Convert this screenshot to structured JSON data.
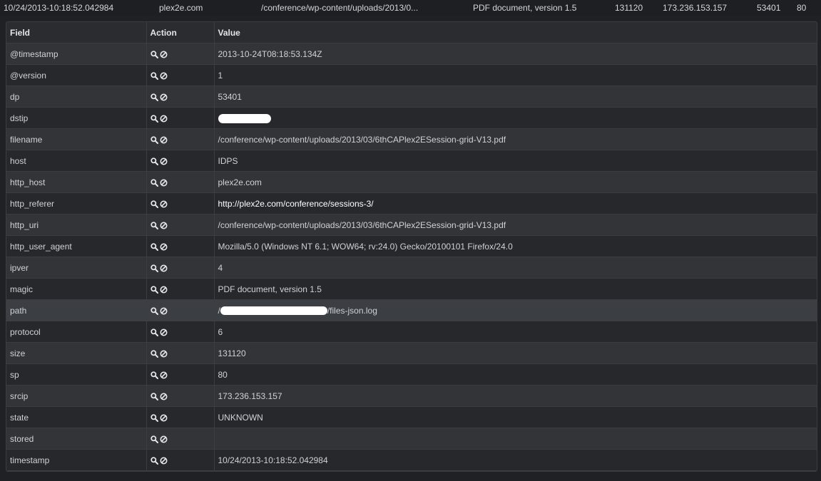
{
  "summary": {
    "timestamp": "10/24/2013-10:18:52.042984",
    "host": "plex2e.com",
    "uri": "/conference/wp-content/uploads/2013/0...",
    "magic": "PDF document, version 1.5",
    "size": "131120",
    "srcip": "173.236.153.157",
    "dp": "53401",
    "sp": "80"
  },
  "table": {
    "headers": {
      "field": "Field",
      "action": "Action",
      "value": "Value"
    },
    "rows": [
      {
        "field": "@timestamp",
        "value": "2013-10-24T08:18:53.134Z"
      },
      {
        "field": "@version",
        "value": "1"
      },
      {
        "field": "dp",
        "value": "53401"
      },
      {
        "field": "dstip",
        "value": ""
      },
      {
        "field": "filename",
        "value": "/conference/wp-content/uploads/2013/03/6thCAPlex2ESession-grid-V13.pdf"
      },
      {
        "field": "host",
        "value": "IDPS"
      },
      {
        "field": "http_host",
        "value": "plex2e.com"
      },
      {
        "field": "http_referer",
        "value": "http://plex2e.com/conference/sessions-3/"
      },
      {
        "field": "http_uri",
        "value": "/conference/wp-content/uploads/2013/03/6thCAPlex2ESession-grid-V13.pdf"
      },
      {
        "field": "http_user_agent",
        "value": "Mozilla/5.0 (Windows NT 6.1; WOW64; rv:24.0) Gecko/20100101 Firefox/24.0"
      },
      {
        "field": "ipver",
        "value": "4"
      },
      {
        "field": "magic",
        "value": "PDF document, version 1.5"
      },
      {
        "field": "path",
        "value_prefix": "/",
        "value_suffix": "/files-json.log"
      },
      {
        "field": "protocol",
        "value": "6"
      },
      {
        "field": "size",
        "value": "131120"
      },
      {
        "field": "sp",
        "value": "80"
      },
      {
        "field": "srcip",
        "value": "173.236.153.157"
      },
      {
        "field": "state",
        "value": "UNKNOWN"
      },
      {
        "field": "stored",
        "value": ""
      },
      {
        "field": "timestamp",
        "value": "10/24/2013-10:18:52.042984"
      }
    ]
  },
  "icons": {
    "action_1": "magnifier-icon",
    "action_2": "ban-icon"
  },
  "colors": {
    "background": "#1f2124",
    "row_odd": "#323438",
    "row_even": "#26282b",
    "row_highlight": "#3b3e43",
    "text": "#cfd2d6",
    "border": "#3a3d42"
  }
}
